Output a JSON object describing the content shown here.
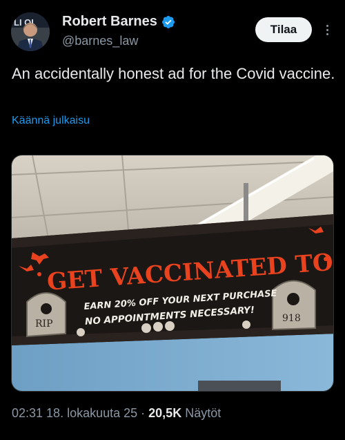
{
  "author": {
    "display_name": "Robert Barnes",
    "handle": "@barnes_law",
    "verified": true,
    "avatar_text": "LI  OI"
  },
  "actions": {
    "subscribe_label": "Tilaa",
    "more_icon": "more-vertical-icon"
  },
  "tweet": {
    "text": "An accidentally honest ad for the Covid vaccine.",
    "translate_label": "Käännä julkaisu"
  },
  "media": {
    "banner_headline": "GET VACCINATED TODAY!",
    "banner_line1": "EARN 20% OFF YOUR NEXT PURCHASE",
    "banner_line2": "NO APPOINTMENTS NECESSARY!",
    "tombstone_left": "RIP",
    "tombstone_right": "918"
  },
  "meta": {
    "time": "02:31",
    "date": "18. lokakuuta 25",
    "separator": "·",
    "views_count": "20,5K",
    "views_label": "Näytöt"
  },
  "colors": {
    "background": "#000000",
    "text": "#e7e9ea",
    "secondary": "#8b98a5",
    "link": "#1d9bf0",
    "verified": "#1d9bf0",
    "banner_orange": "#e8431e"
  }
}
